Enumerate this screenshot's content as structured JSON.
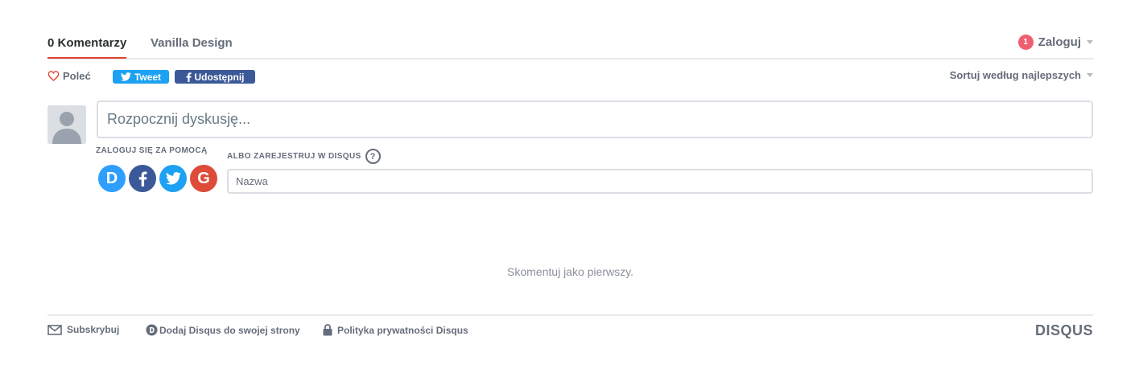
{
  "nav": {
    "comments_tab": "0 Komentarzy",
    "site_tab": "Vanilla Design",
    "notification_count": "1",
    "login_label": "Zaloguj"
  },
  "actions": {
    "recommend_label": "Poleć",
    "tweet_label": "Tweet",
    "share_label": "Udostępnij",
    "sort_label": "Sortuj według najlepszych"
  },
  "composer": {
    "placeholder": "Rozpocznij dyskusję..."
  },
  "login": {
    "login_with_label": "ZALOGUJ SIĘ ZA POMOCĄ",
    "register_label": "ALBO ZAREJESTRUJ W DISQUS",
    "help_glyph": "?",
    "name_placeholder": "Nazwa",
    "providers": [
      {
        "name": "disqus",
        "glyph": "D"
      },
      {
        "name": "facebook",
        "glyph": ""
      },
      {
        "name": "twitter",
        "glyph": ""
      },
      {
        "name": "google",
        "glyph": "G"
      }
    ]
  },
  "empty_message": "Skomentuj jako pierwszy.",
  "footer": {
    "subscribe_label": "Subskrybuj",
    "add_disqus_label": "Dodaj Disqus do swojej strony",
    "privacy_label": "Polityka prywatności Disqus",
    "logo_text": "DISQUS"
  },
  "colors": {
    "accent_red": "#e2412f",
    "badge": "#f05f70",
    "twitter": "#1da1f2",
    "facebook": "#3b5998",
    "disqus_blue": "#2e9fff",
    "google": "#dd4b39",
    "muted_text": "#656c7a",
    "border": "#dbdfe4"
  },
  "icons": {
    "recommend": "heart-icon",
    "subscribe": "envelope-icon",
    "add_disqus": "disqus-d-icon",
    "privacy": "lock-icon",
    "help": "question-icon",
    "dropdown": "caret-down-icon"
  }
}
